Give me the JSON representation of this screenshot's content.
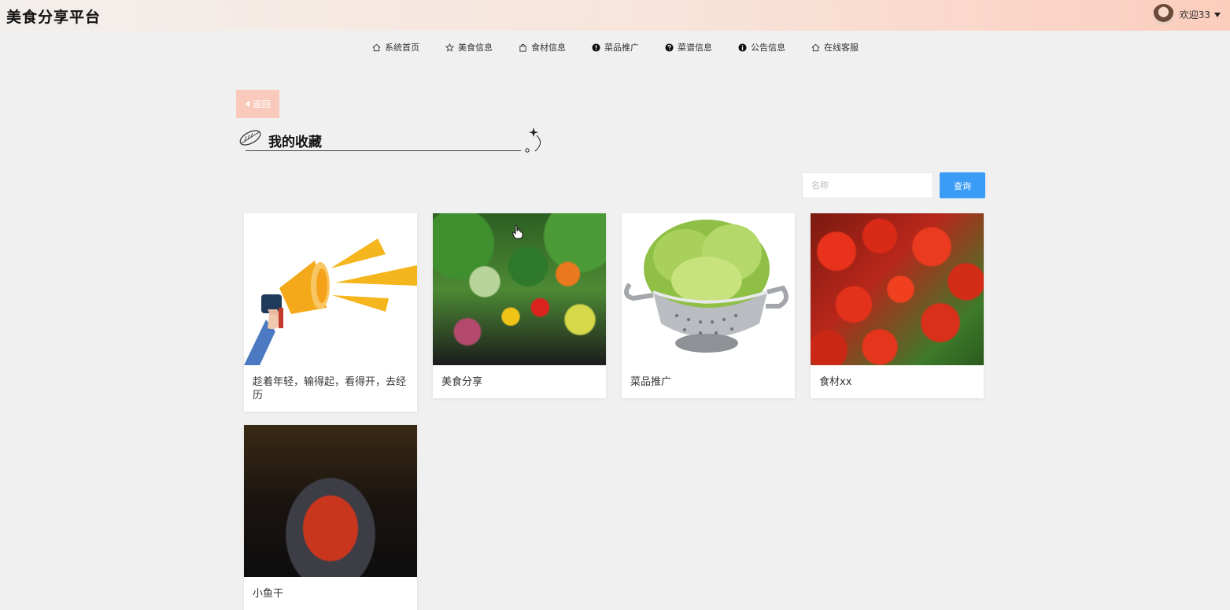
{
  "header": {
    "brand": "美食分享平台",
    "user": {
      "welcome": "欢迎33"
    }
  },
  "nav": {
    "items": [
      {
        "label": "系统首页",
        "icon": "home-icon"
      },
      {
        "label": "美食信息",
        "icon": "star-icon"
      },
      {
        "label": "食材信息",
        "icon": "bag-icon"
      },
      {
        "label": "菜品推广",
        "icon": "exclamation-icon"
      },
      {
        "label": "菜谱信息",
        "icon": "question-icon"
      },
      {
        "label": "公告信息",
        "icon": "info-icon"
      },
      {
        "label": "在线客服",
        "icon": "home-icon"
      }
    ]
  },
  "page": {
    "back_label": "返回",
    "section_title": "我的收藏"
  },
  "search": {
    "placeholder": "名称",
    "value": "",
    "button_label": "查询"
  },
  "favorites": [
    {
      "name": "趁着年轻，输得起，看得开，去经历",
      "image": "megaphone"
    },
    {
      "name": "美食分享",
      "image": "vegetables"
    },
    {
      "name": "菜品推广",
      "image": "cabbage-colander"
    },
    {
      "name": "食材xx",
      "image": "tomatoes"
    },
    {
      "name": "小鱼干",
      "image": "chili-dish"
    }
  ],
  "colors": {
    "accent": "#3a9cf5",
    "back_button": "#f9c9bc",
    "header_gradient_end": "#fbcdbd",
    "page_background": "#f0f0f0"
  }
}
